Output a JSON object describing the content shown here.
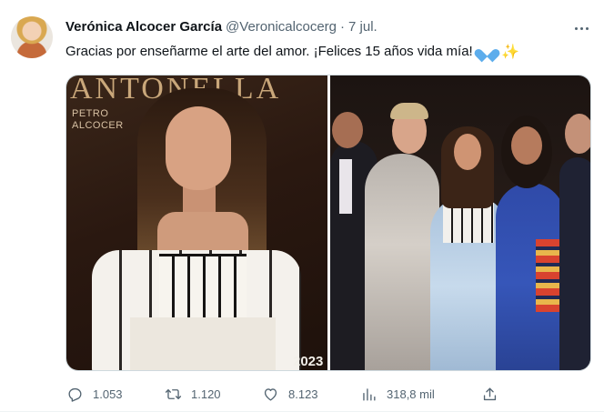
{
  "tweet": {
    "author_name": "Verónica Alcocer García",
    "author_handle": "@Veronicalcocerg",
    "separator": "·",
    "time": "7 jul.",
    "text": "Gracias por enseñarme el arte del amor. ¡Felices 15 años vida mía!",
    "emojis": [
      "blue-heart-icon",
      "sparkles-icon"
    ]
  },
  "media": {
    "left_photo": {
      "poster_title": "ANTONELLA",
      "poster_subtitle": "PETRO ALCOCER",
      "poster_year": "2023"
    }
  },
  "actions": {
    "replies": "1.053",
    "retweets": "1.120",
    "likes": "8.123",
    "views": "318,8 mil"
  },
  "colors": {
    "text": "#0f1419",
    "secondary": "#536471",
    "heart_emoji": "#5dadec",
    "sparkle_emoji": "#f5b400"
  }
}
